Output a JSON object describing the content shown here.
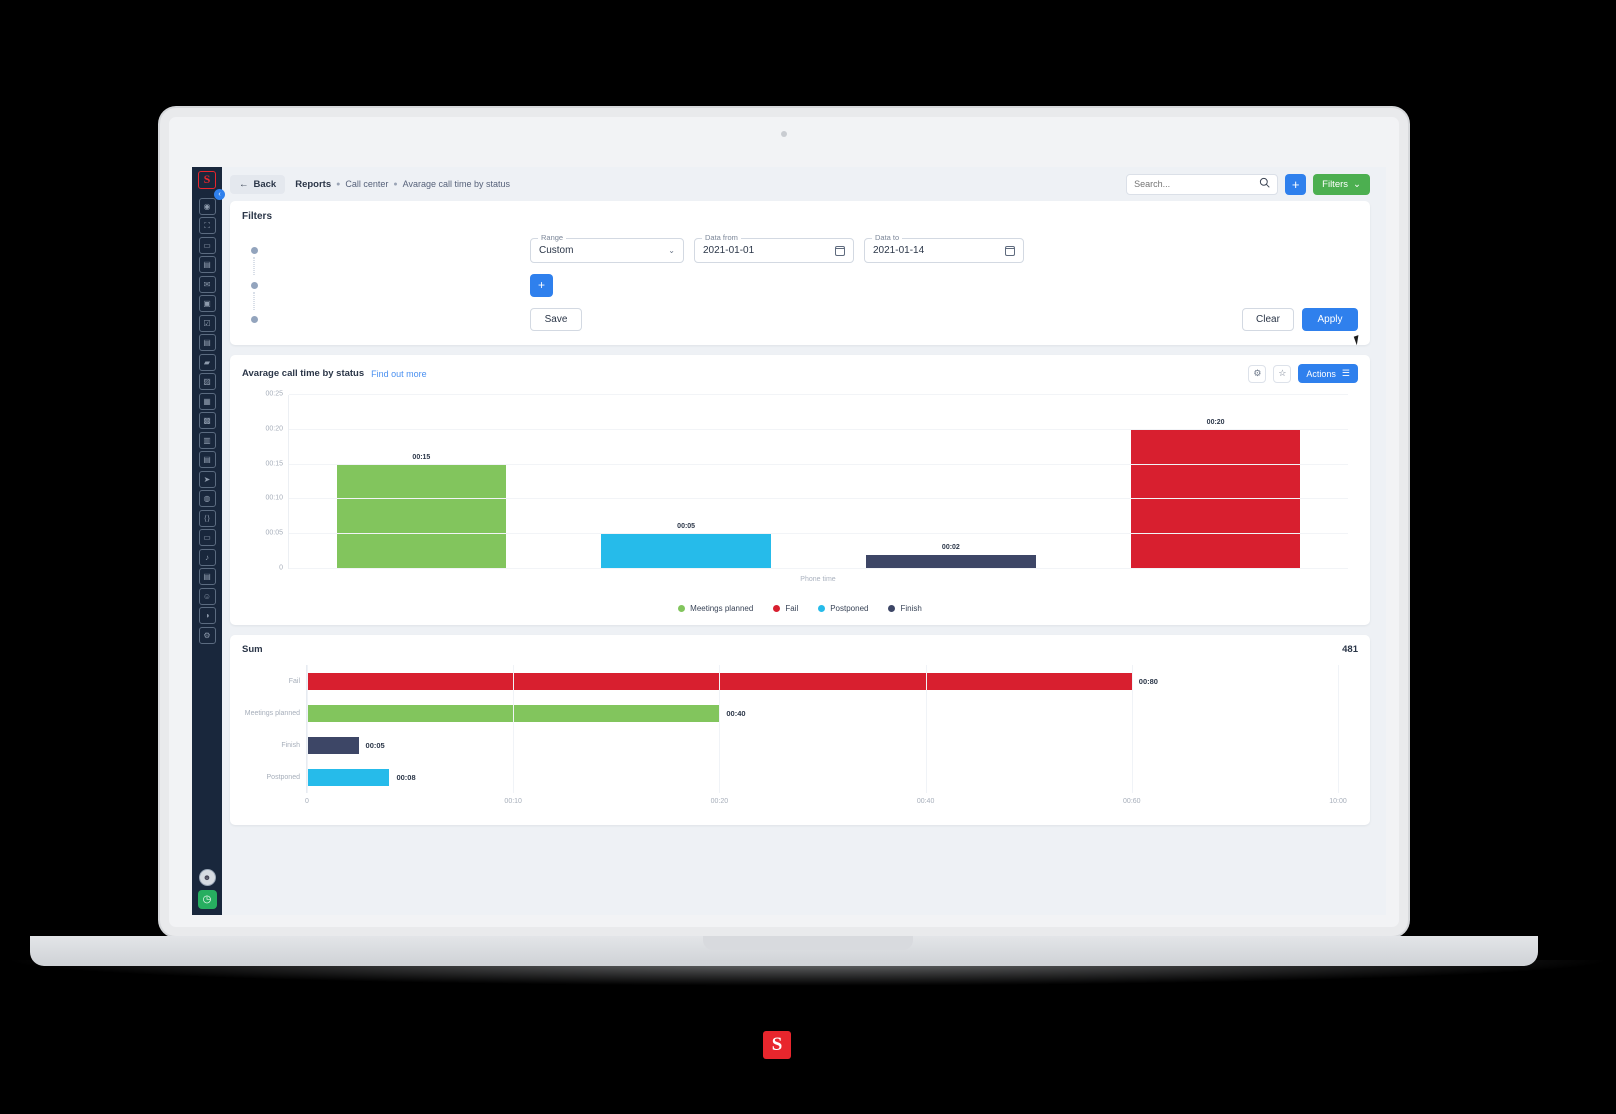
{
  "brand": {
    "logo_letter": "S"
  },
  "sidebar": {
    "collapse_icon": "chevron-left-icon",
    "items": [
      {
        "icon": "dashboard-icon",
        "glyph": "◉"
      },
      {
        "icon": "analytics-icon",
        "glyph": "⛶"
      },
      {
        "icon": "chat-icon",
        "glyph": "▭"
      },
      {
        "icon": "building-icon",
        "glyph": "▤"
      },
      {
        "icon": "mail-icon",
        "glyph": "✉"
      },
      {
        "icon": "calendar-icon",
        "glyph": "▣"
      },
      {
        "icon": "task-icon",
        "glyph": "☑"
      },
      {
        "icon": "briefcase-icon",
        "glyph": "▤"
      },
      {
        "icon": "folder-icon",
        "glyph": "▰"
      },
      {
        "icon": "image-icon",
        "glyph": "▨"
      },
      {
        "icon": "package-icon",
        "glyph": "▦"
      },
      {
        "icon": "store-icon",
        "glyph": "▩"
      },
      {
        "icon": "users-icon",
        "glyph": "▥"
      },
      {
        "icon": "grid-icon",
        "glyph": "▤"
      },
      {
        "icon": "send-icon",
        "glyph": "➤"
      },
      {
        "icon": "cloud-icon",
        "glyph": "◍"
      },
      {
        "icon": "code-icon",
        "glyph": "⟨⟩"
      },
      {
        "icon": "box-icon",
        "glyph": "▭"
      },
      {
        "icon": "bell-icon",
        "glyph": "♪"
      },
      {
        "icon": "list-icon",
        "glyph": "▤"
      },
      {
        "icon": "contacts-icon",
        "glyph": "☺"
      },
      {
        "icon": "megaphone-icon",
        "glyph": "◑"
      },
      {
        "icon": "settings-icon",
        "glyph": "⚙"
      }
    ],
    "avatar": {
      "icon": "avatar-icon",
      "glyph": "☻"
    },
    "timer": {
      "icon": "clock-icon",
      "glyph": "◷"
    }
  },
  "topbar": {
    "back_label": "Back",
    "back_icon": "arrow-left-icon",
    "breadcrumb": {
      "root": "Reports",
      "items": [
        "Call center",
        "Avarage call time by status"
      ]
    },
    "search": {
      "placeholder": "Search...",
      "value": "",
      "icon": "search-icon"
    },
    "add_label": "+",
    "filters_label": "Filters",
    "filters_chevron": "chevron-down-icon"
  },
  "filters_card": {
    "title": "Filters",
    "range": {
      "label": "Range",
      "value": "Custom",
      "chevron": "chevron-down-icon"
    },
    "date_from": {
      "label": "Data from",
      "value": "2021-01-01",
      "icon": "calendar-icon"
    },
    "date_to": {
      "label": "Data to",
      "value": "2021-01-14",
      "icon": "calendar-icon"
    },
    "add_condition_label": "+",
    "save_label": "Save",
    "clear_label": "Clear",
    "apply_label": "Apply"
  },
  "chart_card": {
    "title": "Avarage call time by status",
    "find_out_more": "Find out more",
    "gear_icon": "gear-icon",
    "star_icon": "star-icon",
    "actions_label": "Actions",
    "actions_menu_icon": "menu-icon"
  },
  "sum_card": {
    "title": "Sum",
    "value": "481"
  },
  "chart_data": [
    {
      "type": "bar",
      "title": "Avarage call time by status",
      "orientation": "vertical",
      "categories": [
        "Meetings planned",
        "Postponed",
        "Finish",
        "Fail"
      ],
      "values": [
        15,
        5,
        2,
        20
      ],
      "value_labels": [
        "00:15",
        "00:05",
        "00:02",
        "00:20"
      ],
      "colors": [
        "#82c55d",
        "#26bbea",
        "#3d4666",
        "#d81f2f"
      ],
      "xlabel": "Phone time",
      "ylabel": "",
      "ytick_labels": [
        "00:25",
        "00:20",
        "00:15",
        "00:10",
        "00:05",
        "0"
      ],
      "ytick_values": [
        25,
        20,
        15,
        10,
        5,
        0
      ],
      "ylim": [
        0,
        25
      ],
      "grid": true,
      "legend_position": "bottom",
      "legend": [
        {
          "label": "Meetings planned",
          "color": "#82c55d"
        },
        {
          "label": "Fail",
          "color": "#d81f2f"
        },
        {
          "label": "Postponed",
          "color": "#26bbea"
        },
        {
          "label": "Finish",
          "color": "#3d4666"
        }
      ]
    },
    {
      "type": "bar",
      "title": "Sum",
      "orientation": "horizontal",
      "categories": [
        "Fail",
        "Meetings planned",
        "Finish",
        "Postponed"
      ],
      "values": [
        80,
        40,
        5,
        8
      ],
      "value_labels": [
        "00:80",
        "00:40",
        "00:05",
        "00:08"
      ],
      "colors": [
        "#d81f2f",
        "#82c55d",
        "#3d4666",
        "#26bbea"
      ],
      "xtick_labels": [
        "0",
        "00:10",
        "00:20",
        "00:40",
        "00:60",
        "10:00"
      ],
      "xtick_positions": [
        0,
        20,
        40,
        60,
        80,
        100
      ],
      "xlim": [
        0,
        100
      ],
      "grid": true,
      "legend_position": "none"
    }
  ]
}
